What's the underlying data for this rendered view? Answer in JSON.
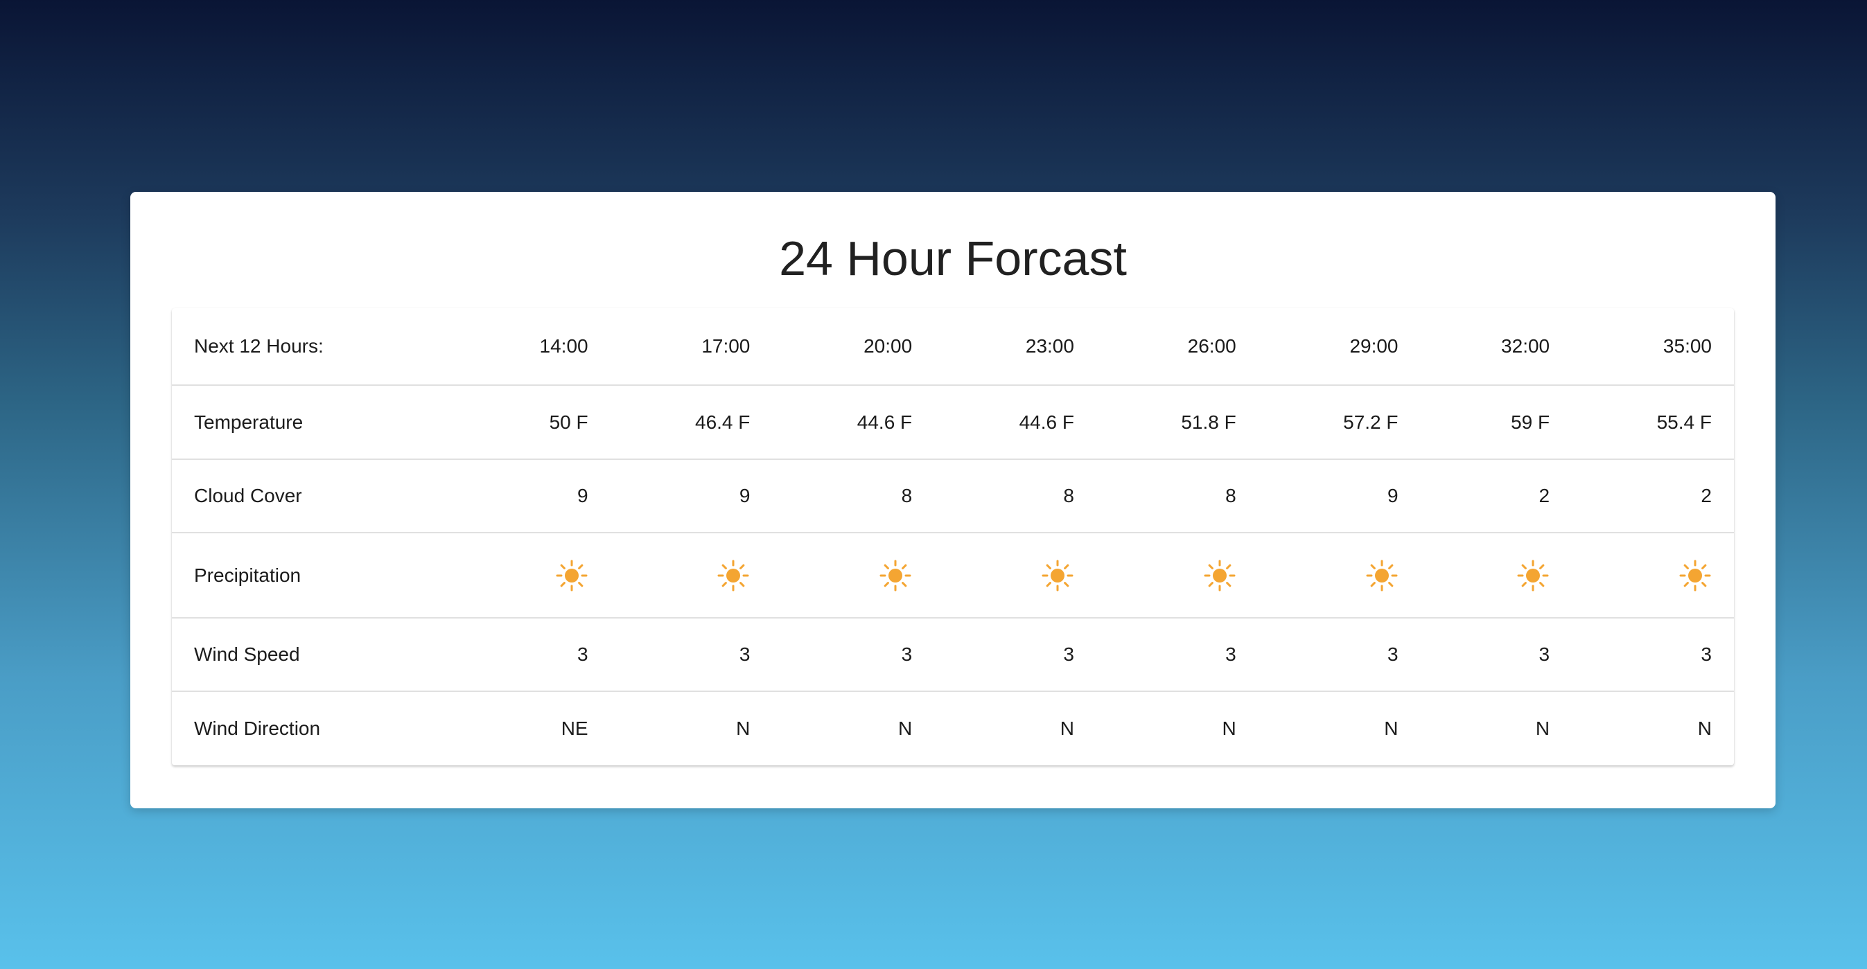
{
  "title": "24 Hour Forcast",
  "table": {
    "header_label": "Next 12 Hours:",
    "times": [
      "14:00",
      "17:00",
      "20:00",
      "23:00",
      "26:00",
      "29:00",
      "32:00",
      "35:00"
    ],
    "rows": [
      {
        "label": "Temperature",
        "values": [
          "50 F",
          "46.4 F",
          "44.6 F",
          "44.6 F",
          "51.8 F",
          "57.2 F",
          "59 F",
          "55.4 F"
        ]
      },
      {
        "label": "Cloud Cover",
        "values": [
          "9",
          "9",
          "8",
          "8",
          "8",
          "9",
          "2",
          "2"
        ]
      },
      {
        "label": "Precipitation",
        "icons": [
          "sun-icon",
          "sun-icon",
          "sun-icon",
          "sun-icon",
          "sun-icon",
          "sun-icon",
          "sun-icon",
          "sun-icon"
        ]
      },
      {
        "label": "Wind Speed",
        "values": [
          "3",
          "3",
          "3",
          "3",
          "3",
          "3",
          "3",
          "3"
        ]
      },
      {
        "label": "Wind Direction",
        "values": [
          "NE",
          "N",
          "N",
          "N",
          "N",
          "N",
          "N",
          "N"
        ]
      }
    ]
  },
  "colors": {
    "sun": "#f4a532",
    "background_top": "#0a1535",
    "background_bottom": "#59c1eb"
  }
}
